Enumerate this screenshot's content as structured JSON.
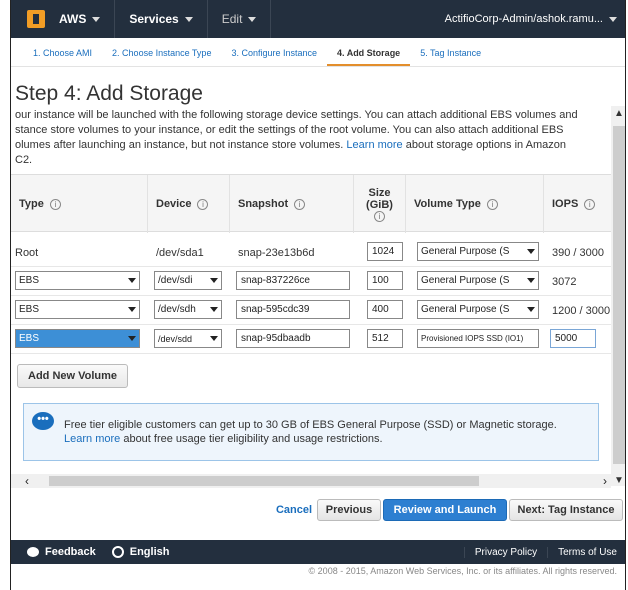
{
  "topnav": {
    "brand": "AWS",
    "services": "Services",
    "edit": "Edit",
    "account": "ActifioCorp-Admin/ashok.ramu..."
  },
  "steps": [
    {
      "label": "1. Choose AMI",
      "active": false
    },
    {
      "label": "2. Choose Instance Type",
      "active": false
    },
    {
      "label": "3. Configure Instance",
      "active": false
    },
    {
      "label": "4. Add Storage",
      "active": true
    },
    {
      "label": "5. Tag Instance",
      "active": false
    }
  ],
  "page": {
    "title": "Step 4: Add Storage",
    "desc_line1": "our instance will be launched with the following storage device settings. You can attach additional EBS volumes and",
    "desc_line2": "stance store volumes to your instance, or edit the settings of the root volume. You can also attach additional EBS",
    "desc_line3_pre": "olumes after launching an instance, but not instance store volumes.",
    "desc_link": "Learn more",
    "desc_line3_post": "about storage options in Amazon",
    "desc_line4": "C2."
  },
  "table": {
    "headers": {
      "type": "Type",
      "device": "Device",
      "snapshot": "Snapshot",
      "size_l1": "Size",
      "size_l2": "(GiB)",
      "volume_type": "Volume Type",
      "iops": "IOPS"
    },
    "rows": [
      {
        "type": "Root",
        "device": "/dev/sda1",
        "snapshot": "snap-23e13b6d",
        "size": "1024",
        "volume_type": "General Purpose (S",
        "iops": "390 / 3000"
      },
      {
        "type": "EBS",
        "device": "/dev/sdi",
        "snapshot": "snap-837226ce",
        "size": "100",
        "volume_type": "General Purpose (S",
        "iops": "3072"
      },
      {
        "type": "EBS",
        "device": "/dev/sdh",
        "snapshot": "snap-595cdc39",
        "size": "400",
        "volume_type": "General Purpose (S",
        "iops": "1200 / 3000"
      },
      {
        "type": "EBS",
        "device": "/dev/sdd",
        "snapshot": "snap-95dbaadb",
        "size": "512",
        "volume_type": "Provisioned IOPS SSD (IO1)",
        "iops": "5000"
      }
    ]
  },
  "add_volume": "Add New Volume",
  "notice": {
    "line1": "Free tier eligible customers can get up to 30 GB of EBS General Purpose (SSD) or Magnetic storage.",
    "link": "Learn more",
    "line2": "about free usage tier eligibility and usage restrictions."
  },
  "buttons": {
    "cancel": "Cancel",
    "previous": "Previous",
    "review": "Review and Launch",
    "next": "Next: Tag Instance"
  },
  "footer": {
    "feedback": "Feedback",
    "language": "English",
    "privacy": "Privacy Policy",
    "terms": "Terms of Use",
    "copyright": "© 2008 - 2015, Amazon Web Services, Inc. or its affiliates. All rights reserved."
  },
  "colors": {
    "nav_bg": "#232f3e",
    "accent": "#e38e2c",
    "link": "#1a6ebd",
    "primary": "#2d7fd1"
  }
}
